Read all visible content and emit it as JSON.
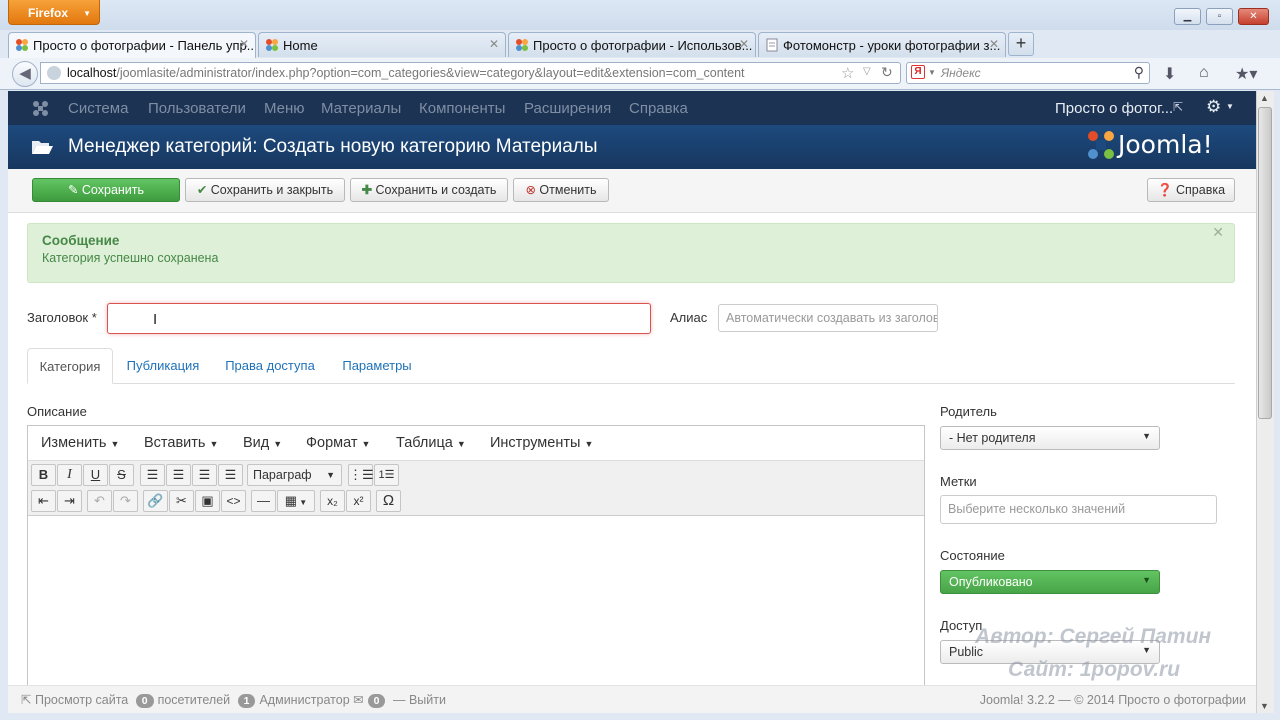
{
  "browser": {
    "menu_label": "Firefox",
    "tabs": [
      {
        "label": "Просто о фотографии - Панель упр..."
      },
      {
        "label": "Home"
      },
      {
        "label": "Просто о фотографии - Использов..."
      },
      {
        "label": "Фотомонстр - уроки фотографии з..."
      }
    ],
    "url_host": "localhost",
    "url_path": "/joomlasite/administrator/index.php?option=com_categories&view=category&layout=edit&extension=com_content",
    "search_placeholder": "Яндекс"
  },
  "admin_nav": {
    "items": [
      "Система",
      "Пользователи",
      "Меню",
      "Материалы",
      "Компоненты",
      "Расширения",
      "Справка"
    ],
    "site_name": "Просто о фотог...",
    "settings_icon": "gear-icon"
  },
  "header": {
    "title": "Менеджер категорий: Создать новую категорию Материалы",
    "logo_text": "Joomla!"
  },
  "toolbar": {
    "save": "Сохранить",
    "save_close": "Сохранить и закрыть",
    "save_new": "Сохранить и создать",
    "cancel": "Отменить",
    "help": "Справка"
  },
  "message": {
    "heading": "Сообщение",
    "text": "Категория успешно сохранена"
  },
  "form": {
    "title_label": "Заголовок *",
    "title_value": "",
    "alias_label": "Алиас",
    "alias_placeholder": "Автоматически создавать из заголовка"
  },
  "form_tabs": [
    "Категория",
    "Публикация",
    "Права доступа",
    "Параметры"
  ],
  "editor": {
    "description_label": "Описание",
    "menus": [
      "Изменить",
      "Вставить",
      "Вид",
      "Формат",
      "Таблица",
      "Инструменты"
    ],
    "format_select": "Параграф"
  },
  "sidebar": {
    "parent_label": "Родитель",
    "parent_value": "- Нет родителя",
    "tags_label": "Метки",
    "tags_placeholder": "Выберите несколько значений",
    "status_label": "Состояние",
    "status_value": "Опубликовано",
    "access_label": "Доступ",
    "access_value": "Public"
  },
  "footer": {
    "view_site": "Просмотр сайта",
    "visitors_count": "0",
    "visitors_label": "посетителей",
    "admins_count": "1",
    "admins_label": "Администратор",
    "messages_count": "0",
    "logout": "Выйти",
    "version": "Joomla! 3.2.2 — © 2014 Просто о фотографии"
  },
  "watermark": {
    "author": "Автор: Сергей Патин",
    "site": "Сайт: 1popov.ru"
  },
  "colors": {
    "nav_bg": "#1c3354",
    "header_bg": "#1d4a7e",
    "save_green": "#46a546",
    "status_green": "#4cae4c",
    "alert_bg": "#dff0d8"
  }
}
